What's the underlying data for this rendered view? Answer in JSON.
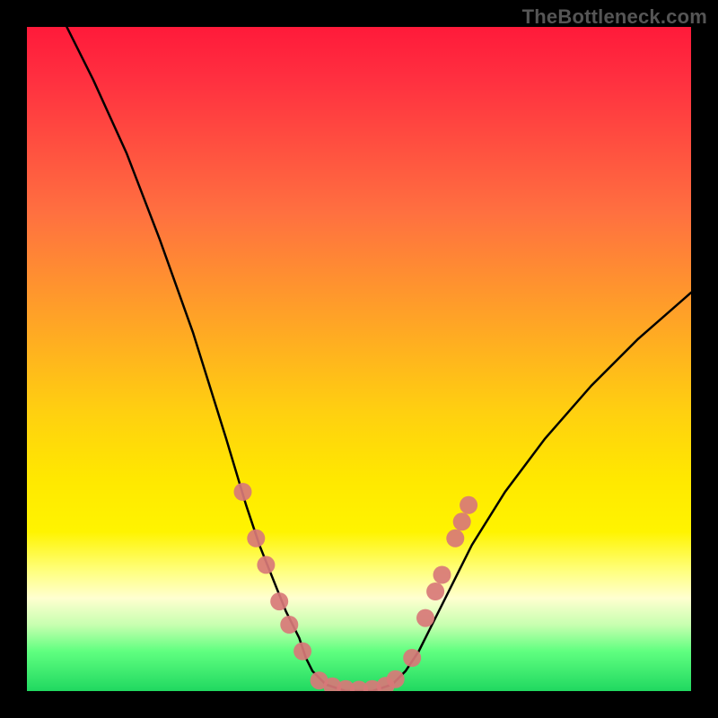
{
  "watermark": "TheBottleneck.com",
  "chart_data": {
    "type": "line",
    "title": "",
    "xlabel": "",
    "ylabel": "",
    "xlim": [
      0,
      100
    ],
    "ylim": [
      0,
      100
    ],
    "grid": false,
    "description": "V-shaped bottleneck curve over a red-to-green vertical heat gradient; trough at the bottom indicates balanced configuration (green = good, red = bad).",
    "series": [
      {
        "name": "bottleneck-curve",
        "color": "#000000",
        "x": [
          6,
          10,
          15,
          20,
          25,
          30,
          33,
          35,
          37,
          39,
          41,
          42,
          43,
          45,
          48,
          52,
          55,
          57,
          59,
          61,
          63,
          67,
          72,
          78,
          85,
          92,
          100
        ],
        "y": [
          100,
          92,
          81,
          68,
          54,
          38,
          28,
          22,
          17,
          12,
          8,
          5,
          3,
          1,
          0,
          0,
          1,
          3,
          6,
          10,
          14,
          22,
          30,
          38,
          46,
          53,
          60
        ]
      }
    ],
    "markers": {
      "name": "highlight-dots",
      "color": "#d87878",
      "radius": 10,
      "points": [
        {
          "x": 32.5,
          "y": 30
        },
        {
          "x": 34.5,
          "y": 23
        },
        {
          "x": 36.0,
          "y": 19
        },
        {
          "x": 38.0,
          "y": 13.5
        },
        {
          "x": 39.5,
          "y": 10
        },
        {
          "x": 41.5,
          "y": 6
        },
        {
          "x": 44.0,
          "y": 1.6
        },
        {
          "x": 46.0,
          "y": 0.7
        },
        {
          "x": 48.0,
          "y": 0.3
        },
        {
          "x": 50.0,
          "y": 0.2
        },
        {
          "x": 52.0,
          "y": 0.3
        },
        {
          "x": 54.0,
          "y": 0.8
        },
        {
          "x": 55.5,
          "y": 1.8
        },
        {
          "x": 58.0,
          "y": 5
        },
        {
          "x": 60.0,
          "y": 11
        },
        {
          "x": 61.5,
          "y": 15
        },
        {
          "x": 62.5,
          "y": 17.5
        },
        {
          "x": 64.5,
          "y": 23
        },
        {
          "x": 65.5,
          "y": 25.5
        },
        {
          "x": 66.5,
          "y": 28
        }
      ]
    }
  }
}
